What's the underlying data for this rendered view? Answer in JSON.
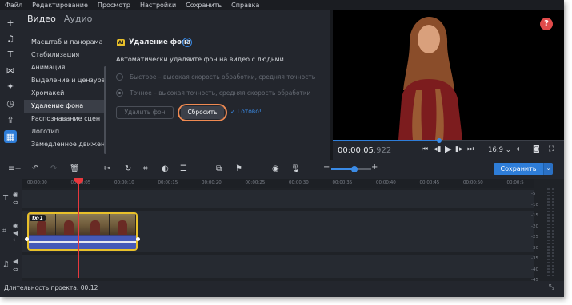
{
  "menu": [
    "Файл",
    "Редактирование",
    "Просмотр",
    "Настройки",
    "Сохранить",
    "Справка"
  ],
  "tabs": {
    "video": "Видео",
    "audio": "Аудио"
  },
  "filters": [
    "Масштаб и панорама",
    "Стабилизация",
    "Анимация",
    "Выделение и цензура",
    "Хромакей",
    "Удаление фона",
    "Распознавание сцен",
    "Логотип",
    "Замедленное движен..."
  ],
  "selected_filter_index": 5,
  "panel": {
    "badge": "AI",
    "title": "Удаление фона",
    "help": "?",
    "description": "Автоматически удаляйте фон на видео с людьми",
    "option_fast": "Быстрое – высокая скорость обработки, средняя точность",
    "option_accurate": "Точное – высокая точность, средняя скорость обработки",
    "btn_remove": "Удалить фон",
    "btn_reset": "Сбросить",
    "done": "✓ Готово!"
  },
  "player": {
    "help": "?",
    "time_main": "00:00:05",
    "time_ms": ".922",
    "ratio": "16:9 ⌄",
    "progress_fraction": 0.46
  },
  "toolbar": {
    "save": "Сохранить",
    "save_dropdown": "⌄"
  },
  "ruler": [
    "00:00:00",
    "00:00:05",
    "00:00:10",
    "00:00:15",
    "00:00:20",
    "00:00:25",
    "00:00:30",
    "00:00:35",
    "00:00:40",
    "00:00:45",
    "00:00:50",
    "00:00:5"
  ],
  "clip": {
    "fx": "fx·1"
  },
  "meter_labels": [
    "-5",
    "-10",
    "-15",
    "-20",
    "-25",
    "-30",
    "-35",
    "-40",
    "-45"
  ],
  "status": "Длительность проекта: 00:12"
}
